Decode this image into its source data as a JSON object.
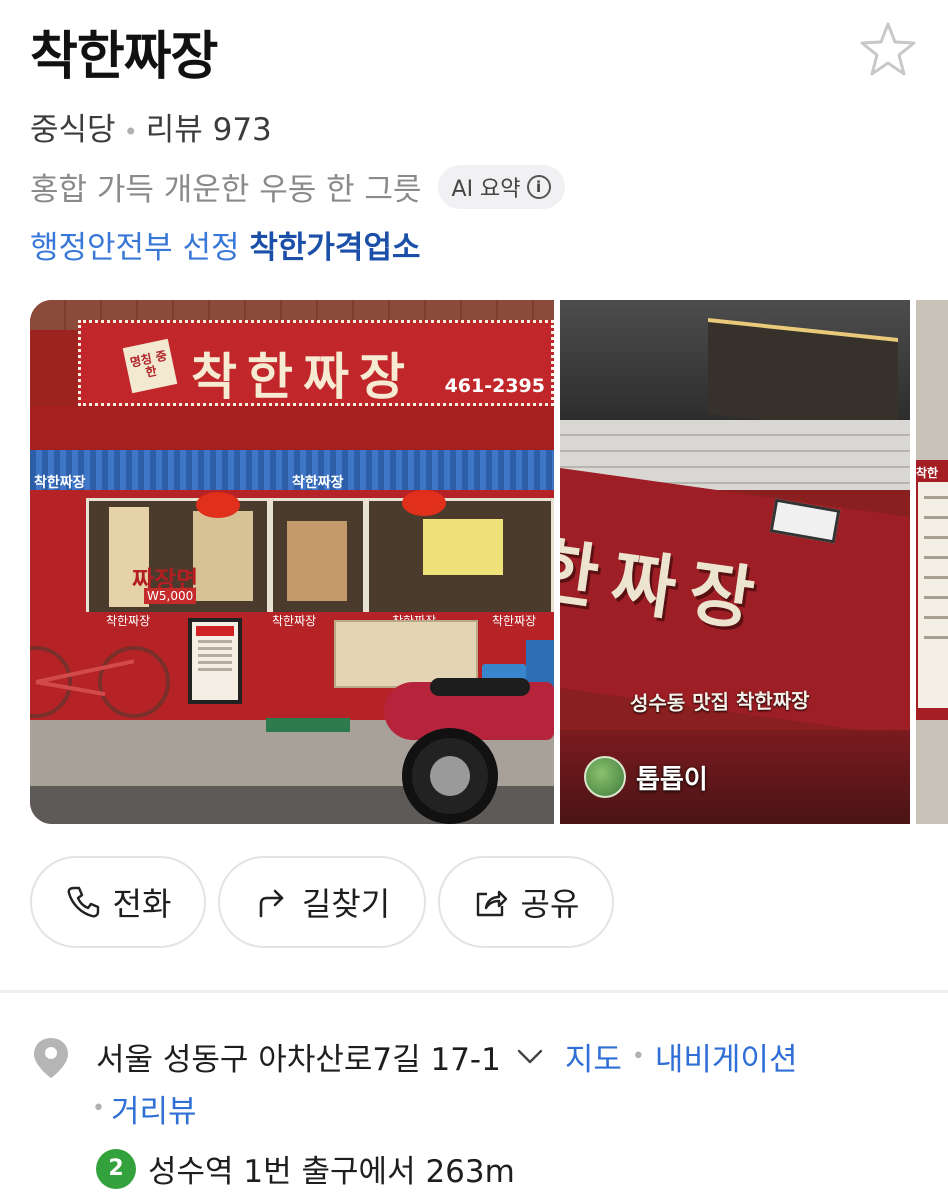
{
  "place": {
    "name": "착한짜장",
    "category": "중식당",
    "review_label": "리뷰 973",
    "summary": "홍합 가득 개운한 우동 한 그릇",
    "ai_chip_label": "AI 요약",
    "ai_info_glyph": "i",
    "cert_prefix": "행정안전부 선정",
    "cert_name": "착한가격업소"
  },
  "photos": {
    "photo1": {
      "sign_text": "착한짜장",
      "sign_badge": "명칭 중한",
      "phone": "461-2395",
      "awning_left": "착한짜장",
      "awning_center": "착한짜장",
      "window_menu": "짜장면",
      "window_price": "W5,000",
      "strip_labels": [
        "착한짜장",
        "착한짜장",
        "착한짜장",
        "착한짜장"
      ]
    },
    "photo2": {
      "sign_text": "한짜장",
      "caption": "성수동 맛집 착한짜장",
      "uploader": "톱톱이"
    },
    "photo3": {
      "header": "착한"
    }
  },
  "actions": {
    "call_label": "전화",
    "route_label": "길찾기",
    "share_label": "공유"
  },
  "address": {
    "text": "서울 성동구 아차산로7길 17-1",
    "map_link": "지도",
    "navi_link": "내비게이션",
    "street_view_link": "거리뷰"
  },
  "transit": {
    "line_number": "2",
    "line_color": "#33a23d",
    "directions": "성수역 1번 출구에서 263m"
  },
  "colors": {
    "link": "#2f6fd6",
    "cert_strong": "#1c4fa8"
  }
}
